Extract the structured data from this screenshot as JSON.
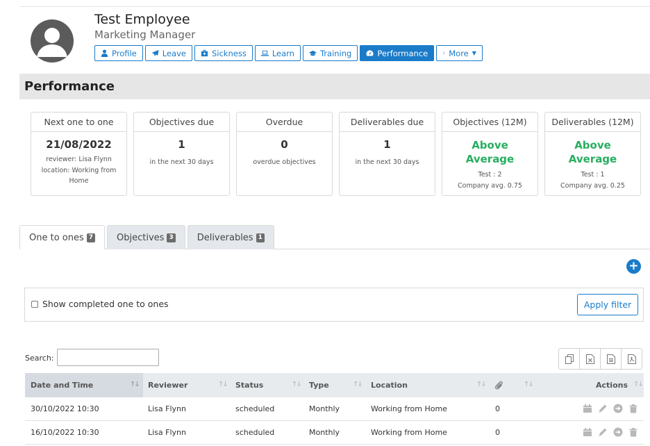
{
  "employee": {
    "name": "Test Employee",
    "role": "Marketing Manager"
  },
  "nav": [
    {
      "label": "Profile",
      "icon": "user-icon"
    },
    {
      "label": "Leave",
      "icon": "plane-icon"
    },
    {
      "label": "Sickness",
      "icon": "medkit-icon"
    },
    {
      "label": "Learn",
      "icon": "laptop-icon"
    },
    {
      "label": "Training",
      "icon": "graduation-cap-icon"
    },
    {
      "label": "Performance",
      "icon": "gauge-icon",
      "active": true
    },
    {
      "label": "More",
      "icon": "vertical-dots-icon"
    }
  ],
  "section_title": "Performance",
  "cards": [
    {
      "title": "Next one to one",
      "value": "21/08/2022",
      "sub1": "reviewer: Lisa Flynn",
      "sub2": "location: Working from Home"
    },
    {
      "title": "Objectives due",
      "value": "1",
      "sub1": "in the next 30 days"
    },
    {
      "title": "Overdue",
      "value": "0",
      "sub1": "overdue objectives"
    },
    {
      "title": "Deliverables due",
      "value": "1",
      "sub1": "in the next 30 days"
    },
    {
      "title": "Objectives (12M)",
      "value": "Above Average",
      "sub1": "Test : 2",
      "sub2": "Company avg. 0.75"
    },
    {
      "title": "Deliverables (12M)",
      "value": "Above Average",
      "sub1": "Test : 1",
      "sub2": "Company avg. 0.25"
    }
  ],
  "tabs": [
    {
      "label": "One to ones",
      "count": "7",
      "active": true
    },
    {
      "label": "Objectives",
      "count": "3"
    },
    {
      "label": "Deliverables",
      "count": "1"
    }
  ],
  "filter": {
    "checkbox_label": "Show completed one to ones",
    "apply_label": "Apply filter"
  },
  "search": {
    "label": "Search:",
    "value": ""
  },
  "export_icons": [
    "copy-icon",
    "excel-icon",
    "csv-icon",
    "pdf-icon"
  ],
  "table": {
    "columns": [
      "Date and Time",
      "Reviewer",
      "Status",
      "Type",
      "Location",
      "",
      "Actions"
    ],
    "attachment_icon": "paperclip-icon",
    "rows": [
      {
        "date": "30/10/2022 10:30",
        "reviewer": "Lisa Flynn",
        "status": "scheduled",
        "type": "Monthly",
        "location": "Working from Home",
        "attachments": "0"
      },
      {
        "date": "16/10/2022 10:30",
        "reviewer": "Lisa Flynn",
        "status": "scheduled",
        "type": "Monthly",
        "location": "Working from Home",
        "attachments": "0"
      }
    ],
    "row_action_icons": [
      "calendar-icon",
      "pencil-icon",
      "arrow-circle-right-icon",
      "trash-icon"
    ]
  },
  "colors": {
    "primary": "#1a7bc9",
    "positive": "#27ae60",
    "header_bar": "#e6e6e6"
  }
}
